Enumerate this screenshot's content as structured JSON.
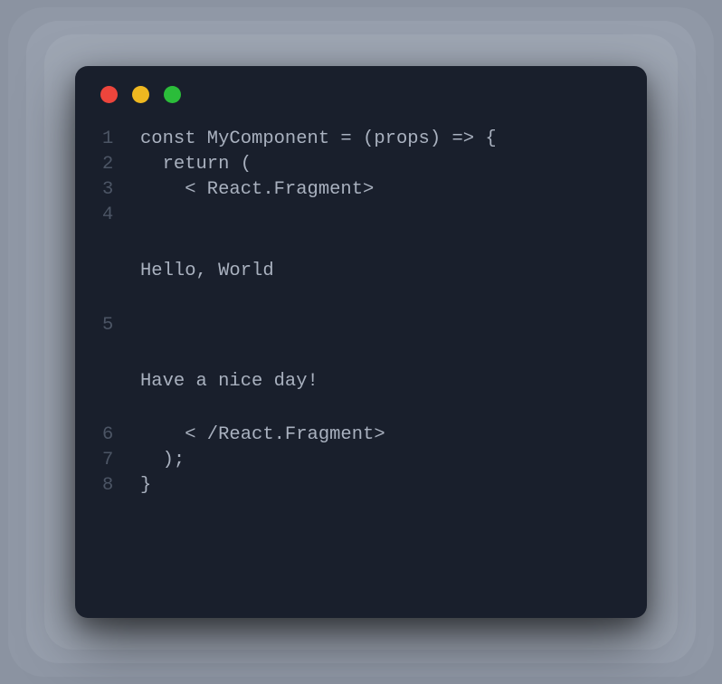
{
  "window": {
    "traffic_lights": {
      "red": "#ed453c",
      "yellow": "#efb820",
      "green": "#2bbd3a"
    }
  },
  "code": {
    "lines": [
      {
        "num": "1",
        "text": "const MyComponent = (props) => {"
      },
      {
        "num": "2",
        "text": "  return ("
      },
      {
        "num": "3",
        "text": "    < React.Fragment>"
      },
      {
        "num": "4",
        "text": ""
      }
    ],
    "output1": "Hello, World",
    "midline": {
      "num": "5",
      "text": ""
    },
    "output2": "Have a nice day!",
    "lines_after": [
      {
        "num": "6",
        "text": "    < /React.Fragment>"
      },
      {
        "num": "7",
        "text": "  );"
      },
      {
        "num": "8",
        "text": "}"
      }
    ]
  }
}
